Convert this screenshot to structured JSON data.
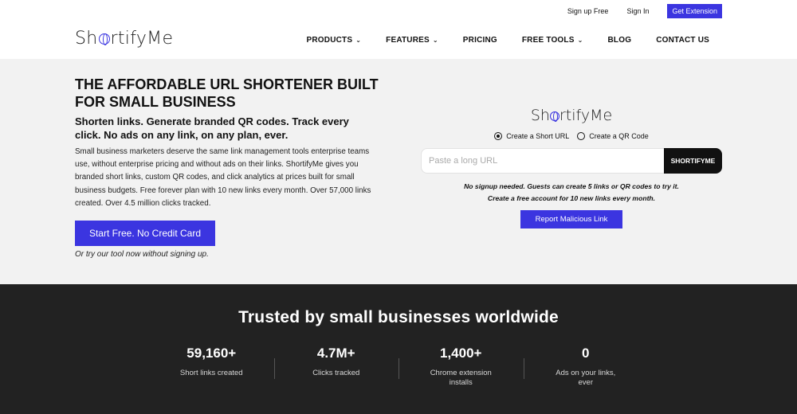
{
  "utility": {
    "signup": "Sign up Free",
    "signin": "Sign In",
    "extension": "Get Extension"
  },
  "header": {
    "logo_pre": "Sh",
    "logo_post": "rtifyMe",
    "nav": [
      {
        "label": "PRODUCTS",
        "dropdown": true
      },
      {
        "label": "FEATURES",
        "dropdown": true
      },
      {
        "label": "PRICING",
        "dropdown": false
      },
      {
        "label": "FREE TOOLS",
        "dropdown": true
      },
      {
        "label": "BLOG",
        "dropdown": false
      },
      {
        "label": "CONTACT US",
        "dropdown": false
      }
    ]
  },
  "hero": {
    "title": "THE AFFORDABLE URL SHORTENER BUILT FOR SMALL BUSINESS",
    "subtitle": "Shorten links. Generate branded QR codes. Track every click. No ads on any link, on any plan, ever.",
    "body": "Small business marketers deserve the same link management tools enterprise teams use, without enterprise pricing and without ads on their links. ShortifyMe gives you branded short links, custom QR codes, and click analytics at prices built for small business budgets. Free forever plan with 10 new links every month. Over 57,000 links created. Over 4.5 million clicks tracked.",
    "cta": "Start Free. No Credit Card",
    "cta_note": "Or try our tool now without signing up."
  },
  "tool": {
    "logo_pre": "Sh",
    "logo_post": "rtifyMe",
    "radio_short": "Create a Short URL",
    "radio_qr": "Create a QR Code",
    "selected": "short",
    "placeholder": "Paste a long URL",
    "button": "SHORTIFYME",
    "note_line1": "No signup needed. Guests can create 5 links or QR codes to try it.",
    "note_line2": "Create a free account for 10 new links every month.",
    "report": "Report Malicious Link"
  },
  "trusted": {
    "title": "Trusted by small businesses worldwide",
    "stats": [
      {
        "value": "59,160+",
        "label": "Short links created"
      },
      {
        "value": "4.7M+",
        "label": "Clicks tracked"
      },
      {
        "value": "1,400+",
        "label": "Chrome extension installs"
      },
      {
        "value": "0",
        "label": "Ads on your links, ever"
      }
    ]
  },
  "colors": {
    "accent": "#3b35e0",
    "dark": "#222222",
    "hero_bg": "#f2f2f2"
  }
}
